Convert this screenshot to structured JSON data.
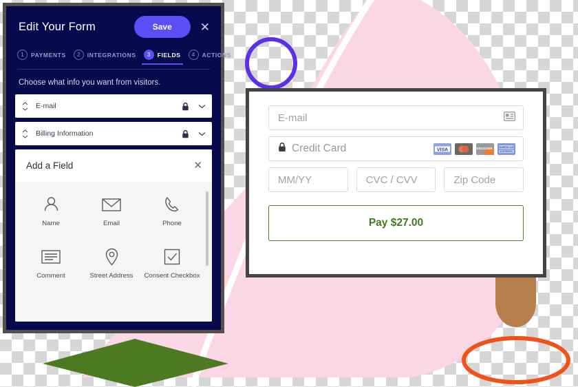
{
  "editor": {
    "title": "Edit Your Form",
    "save_label": "Save",
    "close_icon": "close-icon",
    "subtitle": "Choose what info you want from visitors.",
    "steps": [
      {
        "num": "1",
        "label": "PAYMENTS",
        "active": false
      },
      {
        "num": "2",
        "label": "INTEGRATIONS",
        "active": false
      },
      {
        "num": "3",
        "label": "FIELDS",
        "active": true
      },
      {
        "num": "4",
        "label": "ACTIONS",
        "active": false
      }
    ],
    "field_rows": [
      {
        "label": "E-mail",
        "locked": true
      },
      {
        "label": "Billing Information",
        "locked": true
      }
    ],
    "add_field": {
      "title": "Add a Field",
      "close_icon": "close-icon",
      "tiles": [
        {
          "label": "Name",
          "icon": "person-icon"
        },
        {
          "label": "Email",
          "icon": "envelope-icon"
        },
        {
          "label": "Phone",
          "icon": "phone-icon"
        },
        {
          "label": "Comment",
          "icon": "comment-lines-icon"
        },
        {
          "label": "Street\nAddress",
          "icon": "map-pin-icon"
        },
        {
          "label": "Consent\nCheckbox",
          "icon": "checkbox-checked-icon"
        }
      ]
    }
  },
  "checkout": {
    "email_placeholder": "E-mail",
    "email_autofill_icon": "contact-card-icon",
    "card_placeholder": "Credit Card",
    "card_lock_icon": "lock-icon",
    "card_brands": [
      "VISA",
      "MasterCard",
      "DISCOVER",
      "AMERICAN EXPRESS"
    ],
    "expiry_placeholder": "MM/YY",
    "cvc_placeholder": "CVC / CVV",
    "zip_placeholder": "Zip Code",
    "pay_label": "Pay $27.00"
  },
  "colors": {
    "panel_bg": "#060a4d",
    "accent_purple": "#5b4ef5",
    "panel_border": "#554e49",
    "card_border": "#4a4441",
    "pay_green": "#3f7a1f",
    "blob_pink": "#fbd7e6",
    "diamond_green": "#4b7a22",
    "ellipse_orange": "#f0521a",
    "circle_purple": "#5b31e8",
    "tab_brown": "#b67f4d"
  }
}
